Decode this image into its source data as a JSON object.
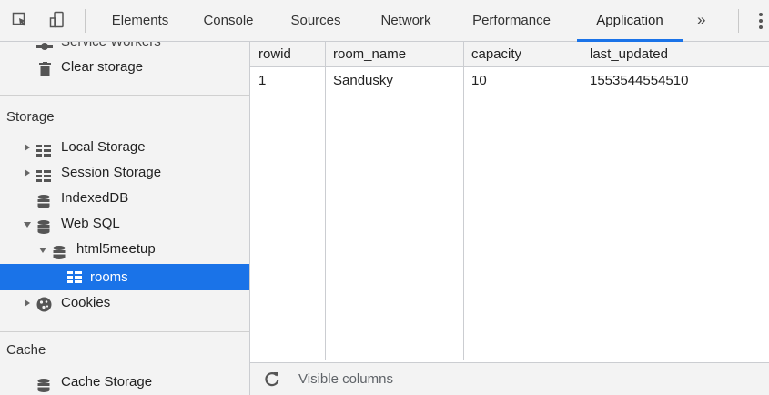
{
  "tabs": [
    {
      "label": "Elements",
      "active": false
    },
    {
      "label": "Console",
      "active": false
    },
    {
      "label": "Sources",
      "active": false
    },
    {
      "label": "Network",
      "active": false
    },
    {
      "label": "Performance",
      "active": false
    },
    {
      "label": "Application",
      "active": true
    }
  ],
  "more_label": "»",
  "accent_color": "#1a73e8",
  "sidebar": {
    "partial_item": {
      "label": "Service Workers",
      "icon": "gear-icon"
    },
    "clear_storage": {
      "label": "Clear storage",
      "icon": "trash-icon"
    },
    "storage_title": "Storage",
    "items": [
      {
        "label": "Local Storage",
        "icon": "grid-icon",
        "expander": "collapsed"
      },
      {
        "label": "Session Storage",
        "icon": "grid-icon",
        "expander": "collapsed"
      },
      {
        "label": "IndexedDB",
        "icon": "database-icon",
        "expander": "none"
      },
      {
        "label": "Web SQL",
        "icon": "database-icon",
        "expander": "expanded"
      },
      {
        "label": "html5meetup",
        "icon": "database-icon",
        "expander": "expanded"
      },
      {
        "label": "rooms",
        "icon": "grid-icon",
        "expander": "none",
        "selected": true
      },
      {
        "label": "Cookies",
        "icon": "cookie-icon",
        "expander": "collapsed"
      }
    ],
    "cache_title": "Cache",
    "cache_items": [
      {
        "label": "Cache Storage",
        "icon": "database-icon"
      }
    ]
  },
  "table": {
    "columns": [
      "rowid",
      "room_name",
      "capacity",
      "last_updated"
    ],
    "rows": [
      [
        "1",
        "Sandusky",
        "10",
        "1553544554510"
      ]
    ]
  },
  "footer": {
    "visible_columns_label": "Visible columns",
    "reload_icon": "reload-icon"
  }
}
